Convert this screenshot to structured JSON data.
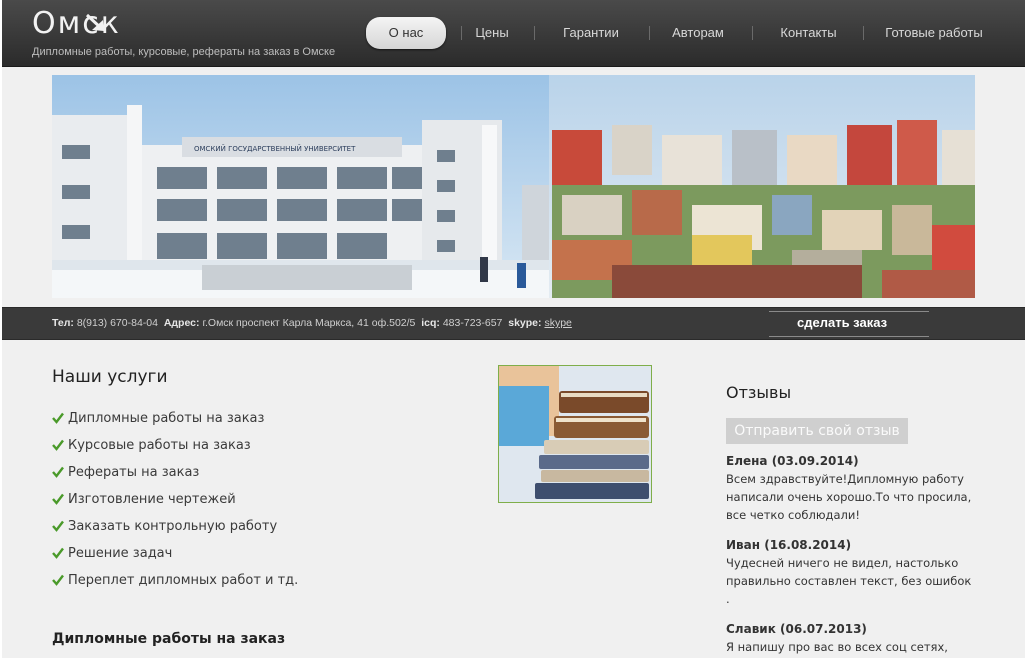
{
  "header": {
    "logo": "Омск",
    "tagline": "Дипломные работы, курсовые, рефераты на заказ в Омске",
    "nav": [
      {
        "label": "О нас",
        "active": true
      },
      {
        "label": "Цены"
      },
      {
        "label": "Гарантии"
      },
      {
        "label": "Авторам"
      },
      {
        "label": "Контакты"
      },
      {
        "label": "Готовые работы"
      }
    ]
  },
  "banner": {
    "building_sign": "ОМСКИЙ ГОСУДАРСТВЕННЫЙ УНИВЕРСИТЕТ"
  },
  "contacts": {
    "tel_label": "Тел:",
    "tel": "8(913) 670-84-04",
    "address_label": "Адрес:",
    "address": "г.Омск проспект Карла Маркса, 41 оф.502/5",
    "icq_label": "icq:",
    "icq": "483-723-657",
    "skype_label": "skype:",
    "skype": "skype",
    "order_label": "сделать заказ"
  },
  "services": {
    "title": "Наши услуги",
    "items": [
      "Дипломные работы на заказ",
      "Курсовые работы на заказ",
      "Рефераты на заказ",
      "Изготовление чертежей",
      "Заказать контрольную работу",
      "Решение задач",
      "Переплет дипломных работ и тд."
    ],
    "subtitle": "Дипломные работы на заказ"
  },
  "reviews": {
    "title": "Отзывы",
    "button": "Отправить свой отзыв",
    "items": [
      {
        "author": "Елена (03.09.2014)",
        "text": "Всем здравствуйте!Дипломную работу написали очень хорошо.То что просила, все четко соблюдали!"
      },
      {
        "author": "Иван (16.08.2014)",
        "text": "Чудесней ничего не видел, настолько правильно составлен текст, без ошибок ."
      },
      {
        "author": "Славик (06.07.2013)",
        "text": "Я напишу про вас во всех соц сетях,"
      }
    ]
  },
  "colors": {
    "header_bg": "#333333",
    "check_green": "#4a9a2a",
    "books_border": "#7fae4a"
  }
}
